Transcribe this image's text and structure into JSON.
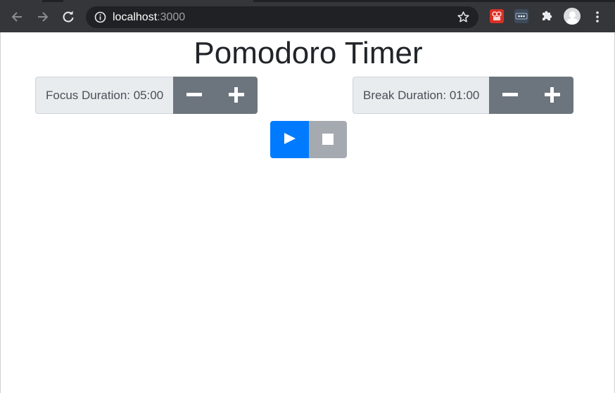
{
  "browser": {
    "url_host": "localhost",
    "url_port": ":3000",
    "icons": {
      "back": "arrow-left-icon",
      "forward": "arrow-right-icon",
      "reload": "reload-icon",
      "info": "info-icon",
      "bookmark": "star-icon",
      "extensions": "puzzle-icon",
      "menu": "kebab-menu-icon"
    }
  },
  "app": {
    "title": "Pomodoro Timer",
    "focus": {
      "label": "Focus Duration: 05:00"
    },
    "break": {
      "label": "Break Duration: 01:00"
    },
    "controls": {
      "play": "play-icon",
      "stop": "stop-icon"
    }
  },
  "colors": {
    "primary": "#007bff",
    "secondary": "#6c757d",
    "stop_disabled": "#a5aab0",
    "label_bg": "#e9ecef",
    "chrome_bg": "#35363a"
  }
}
